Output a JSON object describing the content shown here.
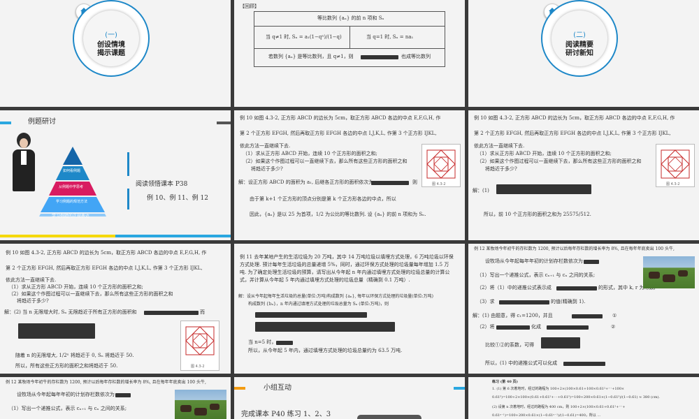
{
  "slide1": {
    "number": "(一)",
    "title1": "创设情境",
    "title2": "揭示课题"
  },
  "slide2": {
    "label": "【回顾】",
    "header": "等比数列 {aₙ} 的前 n 项和 Sₙ",
    "left_case": "当 q≠1 时, Sₙ = a₁(1−qⁿ)/(1−q)",
    "right_case": "当 q=1 时, Sₙ = na₁",
    "footer": "若数列 {aₙ} 是等比数列，且 q≠1，则",
    "footer_tail": "也成等比数列"
  },
  "slide3": {
    "number": "(二)",
    "title1": "阅读精要",
    "title2": "研讨新知"
  },
  "slide4": {
    "heading": "例题研讨",
    "pyramid": [
      "如何看例题",
      "从例题中学思考",
      "学习例题的规范方法",
      "学习例题的正规表达"
    ],
    "read1": "阅读领悟课本 P38",
    "read2": "例 10、例 11、例 12"
  },
  "slide5": {
    "l1": "例 10 如图 4.3-2, 正方形 ABCD 的边长为 5cm，取正方形 ABCD 各边的中点 E,F,G,H, 作",
    "l2": "第 2 个正方形 EFGH, 然后再取正方形 EFGH 各边的中点 I,J,K,L, 作第 3 个正方形 IJKL,",
    "l3": "依此方法一直继续下去.",
    "l4": "（1）求从正方形 ABCD 开始，连续 10 个正方形的面积之和;",
    "l5": "（2）如果这个作图过程可以一直继续下去，那么所有这些正方形的面积之和",
    "l6": "将趋近于多少?",
    "l7": "解：设正方形 ABCD 的面积为 a₁, 后继各正方形的面积依次为",
    "l7b": "则",
    "l8": "由于第 k+1 个正方形的顶点分别是第 k 个正方形各边的中点，所以",
    "l9": "因此，{aₙ} 是以 25 为首项，1/2 为公比的等比数列. 设 {aₙ} 的前 n 项和为 Sₙ.",
    "fig": "图 4.3-2"
  },
  "slide6": {
    "l1": "例 10 如图 4.3-2, 正方形 ABCD 的边长为 5cm，取正方形 ABCD 各边的中点 E,F,G,H, 作",
    "l2": "第 2 个正方形 EFGH, 然后再取正方形 EFGH 各边的中点 I,J,K,L, 作第 3 个正方形 IJKL,",
    "l3": "依此方法一直继续下去.",
    "l4": "（1）求从正方形 ABCD 开始，连续 10 个正方形的面积之和;",
    "l5": "（2）如果这个作图过程可以一直继续下去，那么所有这些正方形的面积之和",
    "l6": "将趋近于多少?",
    "l7": "解：(1)",
    "l8": "所以，前 10 个正方形的面积之和为 25575/512.",
    "fig": "图 4.3-2"
  },
  "slide7": {
    "l1": "例 10 如图 4.3-2, 正方形 ABCD 的边长为 5cm，取正方形 ABCD 各边的中点 E,F,G,H, 作",
    "l2": "第 2 个正方形 EFGH, 然后再取正方形 EFGH 各边的中点 I,J,K,L, 作第 3 个正方形 IJKL,",
    "l3": "依此方法一直继续下去.",
    "l4": "（1）求从正方形 ABCD 开始，连续 10 个正方形的面积之和;",
    "l5": "（2）如果这个作图过程可以一直继续下去，那么所有这些正方形的面积之和",
    "l6": "将趋近于多少?",
    "l7": "解：(2) 当 n 无限增大时, Sₙ 无限趋近于所有正方形的面积和",
    "l7b": "而",
    "l8": "随着 n 的无限增大, 1/2ⁿ 将趋近于 0, Sₙ 将趋近于 50.",
    "l9": "所以，所有这些正方形的面积之和将趋近于 50.",
    "fig": "图 4.3-2"
  },
  "slide8": {
    "l1": "例 11 去年某地产生的生活垃圾为 20 万吨，其中 14 万吨垃圾以填埋方式处理，6 万吨垃圾以环保",
    "l2": "方式处理. 预计每年生活垃圾的总量递增 5%，同时，通过环保方式处理的垃圾量每年增加 1.5 万",
    "l3": "吨. 为了确定处理生活垃圾的预算，请写出从今年起 n 年内通过填埋方式处理的垃圾总量的计算公",
    "l4": "式，并计算从今年起 5 年内通过填埋方式处理的垃圾总量（精确到 0.1 万吨）.",
    "l5": "解：设从今年起每年生活垃圾的总量(单位:万吨)构成数列 {aₙ}, 每年以环保方式处理的垃圾量(单位:万吨)",
    "l6": "构成数列 {bₙ}，n 年内通过填埋方式处理的垃圾总量为 Sₙ (单位:万吨)，则",
    "l7": "当 n=5 时，",
    "l8": "所以，从今年起 5 年内，通过填埋方式处理的垃圾总量约为 63.5 万吨."
  },
  "slide9": {
    "l1": "例 12 某牧场今年初牛的存栏数为 1200, 预计以后每年存栏数的增长率为 8%, 且在每年年底卖出 100 头牛,",
    "l2": "设牧场从今年起每年年初的计划存栏数依次为",
    "l3": "（1）写出一个递推公式，表示 cₙ₊₁ 与 cₙ 之间的关系;",
    "l4": "（2）将（1）中的递推公式表示成",
    "l4b": "的形式，其中 k, r 为常数;",
    "l5": "（3）求",
    "l5b": "的值(精确到 1).",
    "l6": "解：(1) 由题意，得 c₁=1200，并且",
    "l6b": "①",
    "l7": "（2）将",
    "l7b": "化成",
    "l7c": "②",
    "l8": "比较①②的系数，可得",
    "l9": "所以，(1) 中的递推公式可以化成"
  },
  "slide10": {
    "l1": "例 12 某牧场今年初牛的存栏数为 1200, 预计以后每年存栏数的增长率为 8%, 且在每年年底卖出 100 头牛,",
    "l2": "设牧场从今年起每年年初的计划存栏数依次为",
    "l3": "（1）写出一个递推公式，表示 cₙ₊₁ 与 cₙ 之间的关系;"
  },
  "slide11": {
    "heading": "小组互动",
    "text": "完成课本 P40 练习 1、2、3"
  },
  "slide12": {
    "title": "练习 (第 40 页)",
    "l1": "1. (1) 第 6 次着地时，经过的路程为 100+2×(100×0.61+100×0.61²+⋯+100×",
    "l2": "0.61⁵)=100+2×100×(0.61+0.61²+⋯+0.61⁵)=100+200×0.61×(1−0.61⁵)/(1−0.61) ≈ 380 (cm).",
    "l3": "(2) 设第 n 次着地时，经过的路程为 400 cm，则 100+2×(100×0.61+0.61²+⋯+",
    "l4": "0.61ⁿ⁻¹)=100+200×0.61×(1−0.61ⁿ⁻¹)/(1−0.61)=400，所以 ..."
  }
}
